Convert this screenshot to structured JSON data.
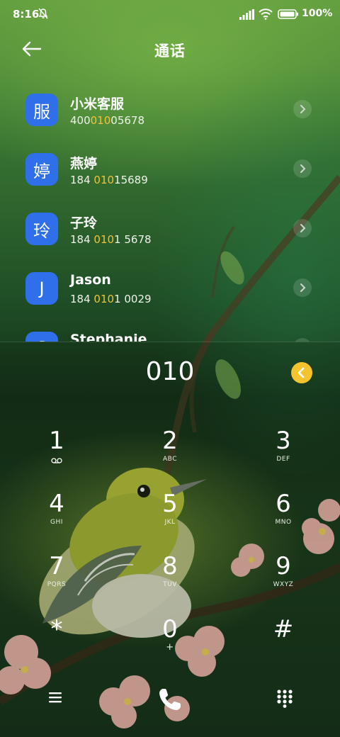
{
  "status_bar": {
    "time": "8:16",
    "battery": "100%",
    "icons": [
      "mute-bell-icon",
      "signal-icon",
      "wifi-icon",
      "battery-icon"
    ]
  },
  "header": {
    "title": "通话",
    "back_icon": "back-arrow-icon"
  },
  "contacts": [
    {
      "avatar": "服",
      "name": "小米客服",
      "num_pre": "400",
      "num_hl": "010",
      "num_post": "05678"
    },
    {
      "avatar": "婷",
      "name": "燕婷",
      "num_pre": "184 ",
      "num_hl": "010",
      "num_post": "15689"
    },
    {
      "avatar": "玲",
      "name": "子玲",
      "num_pre": "184 ",
      "num_hl": "010",
      "num_post": "1 5678"
    },
    {
      "avatar": "J",
      "name": "Jason",
      "num_pre": "184 ",
      "num_hl": "010",
      "num_post": "1 0029"
    },
    {
      "avatar": "S",
      "name": "Stephanie",
      "num_pre": "",
      "num_hl": "",
      "num_post": ""
    }
  ],
  "dialpad": {
    "entered": "010",
    "keys": [
      {
        "digit": "1",
        "letters": ""
      },
      {
        "digit": "2",
        "letters": "ABC"
      },
      {
        "digit": "3",
        "letters": "DEF"
      },
      {
        "digit": "4",
        "letters": "GHI"
      },
      {
        "digit": "5",
        "letters": "JKL"
      },
      {
        "digit": "6",
        "letters": "MNO"
      },
      {
        "digit": "7",
        "letters": "PQRS"
      },
      {
        "digit": "8",
        "letters": "TUV"
      },
      {
        "digit": "9",
        "letters": "WXYZ"
      },
      {
        "digit": "*",
        "letters": ""
      },
      {
        "digit": "0",
        "letters": "+"
      },
      {
        "digit": "#",
        "letters": ""
      }
    ]
  },
  "bottom_bar": {
    "icons": [
      "menu-icon",
      "call-icon",
      "dialpad-icon"
    ]
  },
  "colors": {
    "avatar": "#2f6fe9",
    "highlight": "#f2c23a",
    "backspace": "#f4c430"
  }
}
